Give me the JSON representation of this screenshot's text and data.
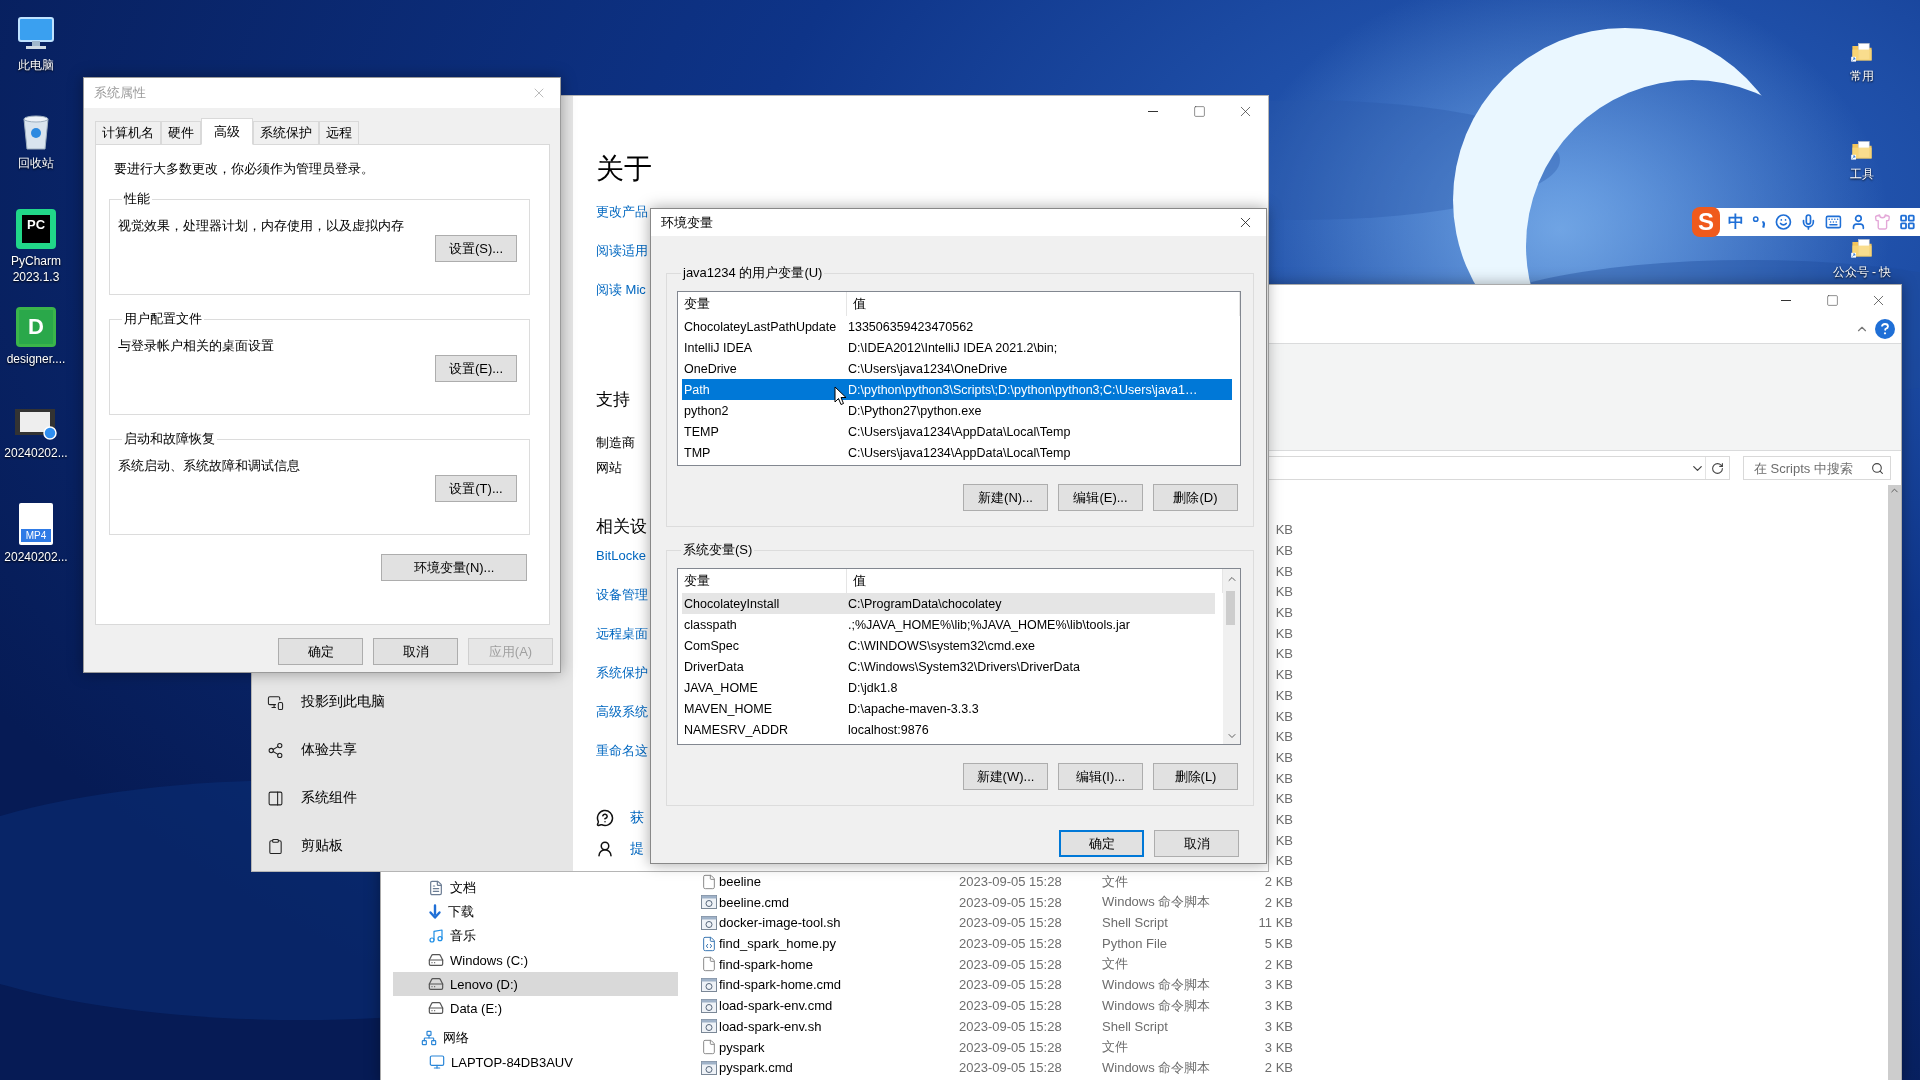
{
  "desktop_left": [
    {
      "label": "此电脑",
      "kind": "this-pc"
    },
    {
      "label": "回收站",
      "kind": "recycle-bin"
    },
    {
      "label": "PyCharm 2023.1.3",
      "kind": "app",
      "badge": "PC",
      "color": "#21d789"
    },
    {
      "label": "designer....",
      "kind": "app",
      "badge": "D",
      "color": "#3bb54a"
    },
    {
      "label": "20240202...",
      "kind": "video"
    },
    {
      "label": "20240202...",
      "kind": "mp4",
      "badge": "MP4"
    }
  ],
  "desktop_right": [
    {
      "label": "常用",
      "kind": "folder"
    },
    {
      "label": "工具",
      "kind": "folder"
    },
    {
      "label": "公众号 - 快",
      "kind": "folder"
    }
  ],
  "ime_toolbar": {
    "logo": "S",
    "mode": "中"
  },
  "explorer": {
    "search": {
      "placeholder": "在 Scripts 中搜索"
    },
    "nav": [
      {
        "label": "文档",
        "kind": "documents",
        "selected": false
      },
      {
        "label": "下载",
        "kind": "downloads",
        "selected": false
      },
      {
        "label": "音乐",
        "kind": "music",
        "selected": false
      },
      {
        "label": "Windows (C:)",
        "kind": "drive",
        "selected": false
      },
      {
        "label": "Lenovo (D:)",
        "kind": "drive",
        "selected": true
      },
      {
        "label": "Data (E:)",
        "kind": "drive",
        "selected": false
      },
      {
        "label": "网络",
        "kind": "network",
        "selected": false,
        "children": [
          {
            "label": "LAPTOP-84DB3AUV",
            "kind": "computer",
            "selected": false
          }
        ]
      }
    ],
    "partial_sizes": [
      "KB",
      "KB",
      "KB",
      "KB",
      "KB",
      "KB",
      "KB",
      "KB",
      "KB",
      "KB",
      "KB",
      "KB",
      "KB",
      "KB",
      "KB",
      "KB",
      "KB"
    ],
    "files": [
      {
        "name": "beeline",
        "date": "2023-09-05 15:28",
        "type": "文件",
        "size": "2 KB",
        "kind": "file"
      },
      {
        "name": "beeline.cmd",
        "date": "2023-09-05 15:28",
        "type": "Windows 命令脚本",
        "size": "2 KB",
        "kind": "script"
      },
      {
        "name": "docker-image-tool.sh",
        "date": "2023-09-05 15:28",
        "type": "Shell Script",
        "size": "11 KB",
        "kind": "script"
      },
      {
        "name": "find_spark_home.py",
        "date": "2023-09-05 15:28",
        "type": "Python File",
        "size": "5 KB",
        "kind": "python"
      },
      {
        "name": "find-spark-home",
        "date": "2023-09-05 15:28",
        "type": "文件",
        "size": "2 KB",
        "kind": "file"
      },
      {
        "name": "find-spark-home.cmd",
        "date": "2023-09-05 15:28",
        "type": "Windows 命令脚本",
        "size": "3 KB",
        "kind": "script"
      },
      {
        "name": "load-spark-env.cmd",
        "date": "2023-09-05 15:28",
        "type": "Windows 命令脚本",
        "size": "3 KB",
        "kind": "script"
      },
      {
        "name": "load-spark-env.sh",
        "date": "2023-09-05 15:28",
        "type": "Shell Script",
        "size": "3 KB",
        "kind": "script"
      },
      {
        "name": "pyspark",
        "date": "2023-09-05 15:28",
        "type": "文件",
        "size": "3 KB",
        "kind": "file"
      },
      {
        "name": "pyspark.cmd",
        "date": "2023-09-05 15:28",
        "type": "Windows 命令脚本",
        "size": "2 KB",
        "kind": "script"
      }
    ]
  },
  "settings": {
    "heading": "关于",
    "links": [
      "更改产品",
      "阅读适用",
      "阅读 Mic"
    ],
    "support": {
      "heading": "支持",
      "items": [
        "制造商",
        "网站"
      ]
    },
    "related": {
      "heading": "相关设",
      "links": [
        "BitLocke",
        "设备管理",
        "远程桌面",
        "系统保护",
        "高级系统",
        "重命名这"
      ]
    },
    "help_links": [
      {
        "label": "获",
        "kind": "help"
      },
      {
        "label": "提",
        "kind": "feedback"
      }
    ],
    "sidebar": [
      {
        "label": "投影到此电脑",
        "kind": "projection"
      },
      {
        "label": "体验共享",
        "kind": "share"
      },
      {
        "label": "系统组件",
        "kind": "components"
      },
      {
        "label": "剪贴板",
        "kind": "clipboard"
      }
    ]
  },
  "system_properties": {
    "title": "系统属性",
    "tabs": [
      {
        "label": "计算机名",
        "selected": false
      },
      {
        "label": "硬件",
        "selected": false
      },
      {
        "label": "高级",
        "selected": true
      },
      {
        "label": "系统保护",
        "selected": false
      },
      {
        "label": "远程",
        "selected": false
      }
    ],
    "notice": "要进行大多数更改，你必须作为管理员登录。",
    "groups": [
      {
        "title": "性能",
        "description": "视觉效果，处理器计划，内存使用，以及虚拟内存",
        "button": "设置(S)..."
      },
      {
        "title": "用户配置文件",
        "description": "与登录帐户相关的桌面设置",
        "button": "设置(E)..."
      },
      {
        "title": "启动和故障恢复",
        "description": "系统启动、系统故障和调试信息",
        "button": "设置(T)..."
      }
    ],
    "env_button": "环境变量(N)...",
    "buttons": [
      {
        "label": "确定",
        "disabled": false
      },
      {
        "label": "取消",
        "disabled": false
      },
      {
        "label": "应用(A)",
        "disabled": true
      }
    ]
  },
  "env_dialog": {
    "title": "环境变量",
    "user_vars": {
      "title": "java1234 的用户变量(U)",
      "columns": [
        "变量",
        "值"
      ],
      "rows": [
        {
          "name": "ChocolateyLastPathUpdate",
          "value": "133506359423470562",
          "selected": false
        },
        {
          "name": "IntelliJ IDEA",
          "value": "D:\\IDEA2012\\IntelliJ IDEA 2021.2\\bin;",
          "selected": false
        },
        {
          "name": "OneDrive",
          "value": "C:\\Users\\java1234\\OneDrive",
          "selected": false
        },
        {
          "name": "Path",
          "value": "D:\\python\\python3\\Scripts\\;D:\\python\\python3;C:\\Users\\java1…",
          "selected": true
        },
        {
          "name": "python2",
          "value": "D:\\Python27\\python.exe",
          "selected": false
        },
        {
          "name": "TEMP",
          "value": "C:\\Users\\java1234\\AppData\\Local\\Temp",
          "selected": false
        },
        {
          "name": "TMP",
          "value": "C:\\Users\\java1234\\AppData\\Local\\Temp",
          "selected": false
        }
      ],
      "buttons": [
        "新建(N)...",
        "编辑(E)...",
        "删除(D)"
      ]
    },
    "system_vars": {
      "title": "系统变量(S)",
      "columns": [
        "变量",
        "值"
      ],
      "rows": [
        {
          "name": "ChocolateyInstall",
          "value": "C:\\ProgramData\\chocolatey",
          "selected": false,
          "hovered": true
        },
        {
          "name": "classpath",
          "value": ".;%JAVA_HOME%\\lib;%JAVA_HOME%\\lib\\tools.jar",
          "selected": false,
          "hovered": false
        },
        {
          "name": "ComSpec",
          "value": "C:\\WINDOWS\\system32\\cmd.exe",
          "selected": false,
          "hovered": false
        },
        {
          "name": "DriverData",
          "value": "C:\\Windows\\System32\\Drivers\\DriverData",
          "selected": false,
          "hovered": false
        },
        {
          "name": "JAVA_HOME",
          "value": "D:\\jdk1.8",
          "selected": false,
          "hovered": false
        },
        {
          "name": "MAVEN_HOME",
          "value": "D:\\apache-maven-3.3.3",
          "selected": false,
          "hovered": false
        },
        {
          "name": "NAMESRV_ADDR",
          "value": "localhost:9876",
          "selected": false,
          "hovered": false
        }
      ],
      "buttons": [
        "新建(W)...",
        "编辑(I)...",
        "删除(L)"
      ]
    },
    "buttons": [
      {
        "label": "确定",
        "default": true
      },
      {
        "label": "取消",
        "default": false
      }
    ]
  }
}
